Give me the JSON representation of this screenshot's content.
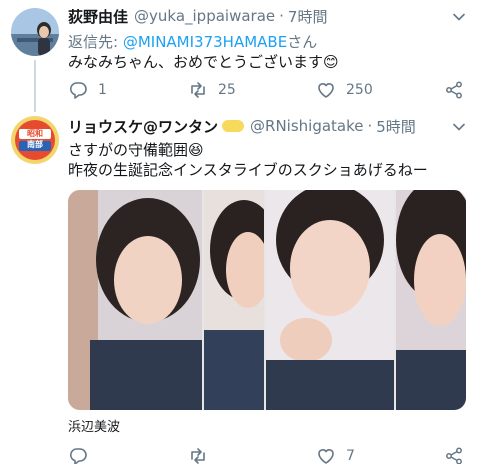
{
  "tweet1": {
    "name": "荻野由佳",
    "handle": "@yuka_ippaiwarae",
    "separator": "·",
    "time": "7時間",
    "reply_prefix": "返信先: ",
    "reply_to": "@MINAMI373HAMABE",
    "reply_suffix": "さん",
    "text": "みなみちゃん、おめでとうございます😊",
    "stats": {
      "replies": "1",
      "retweets": "25",
      "likes": "250"
    }
  },
  "tweet2": {
    "name": "リョウスケ@ワンタン",
    "badge_icon": "emoji-badge-icon",
    "handle": "@RNishigatake",
    "separator": "·",
    "time": "5時間",
    "line1": "さすがの守備範囲😆",
    "line2": "昨夜の生誕記念インスタライブのスクショあげるねー",
    "avatar_text": [
      "昭和",
      "南部"
    ],
    "media_caption": "浜辺美波",
    "stats": {
      "replies": "",
      "retweets": "",
      "likes": "7"
    }
  },
  "icons": {
    "reply": "reply-icon",
    "retweet": "retweet-icon",
    "like": "heart-icon",
    "share": "share-icon",
    "more": "chevron-down-icon"
  },
  "colors": {
    "link": "#1da1f2",
    "muted": "#657786",
    "text": "#14171a"
  }
}
